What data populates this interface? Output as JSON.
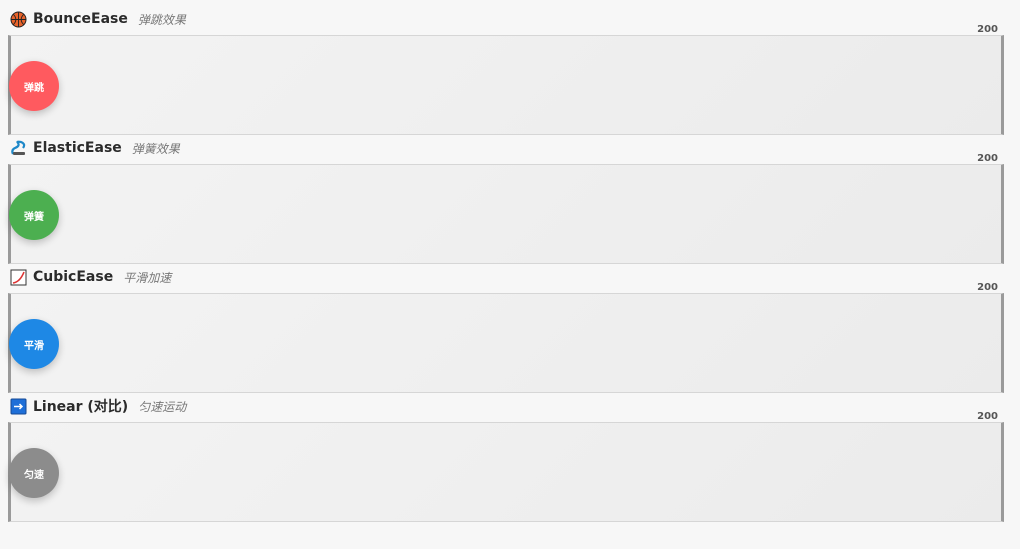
{
  "sections": [
    {
      "title": "BounceEase",
      "subtitle": "弹跳效果",
      "max": "200",
      "ball_label": "弹跳",
      "color": "#ff5a5f",
      "icon": "basketball-icon"
    },
    {
      "title": "ElasticEase",
      "subtitle": "弹簧效果",
      "max": "200",
      "ball_label": "弹簧",
      "color": "#4caf50",
      "icon": "spring-icon"
    },
    {
      "title": "CubicEase",
      "subtitle": "平滑加速",
      "max": "200",
      "ball_label": "平滑",
      "color": "#1e88e5",
      "icon": "chart-curve-icon"
    },
    {
      "title": "Linear (对比)",
      "subtitle": "匀速运动",
      "max": "200",
      "ball_label": "匀速",
      "color": "#8c8c8c",
      "icon": "arrow-right-icon"
    }
  ]
}
